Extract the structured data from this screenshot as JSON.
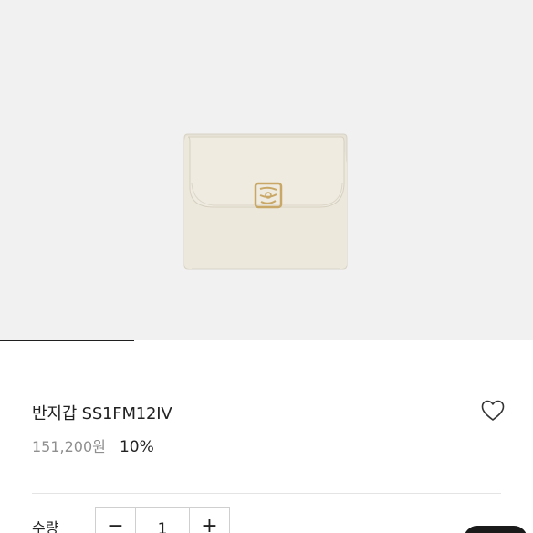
{
  "product": {
    "title": "반지갑 SS1FM12IV",
    "price": "151,200원",
    "discount": "10%"
  },
  "gallery": {
    "background": "#f1f1f1",
    "wallet_color": "#ece8dc",
    "clasp_color": "#c9a867"
  },
  "quantity": {
    "label": "수량",
    "decrement_symbol": "−",
    "value": "1",
    "increment_symbol": "+"
  },
  "icons": {
    "wishlist": "heart-outline-icon"
  }
}
